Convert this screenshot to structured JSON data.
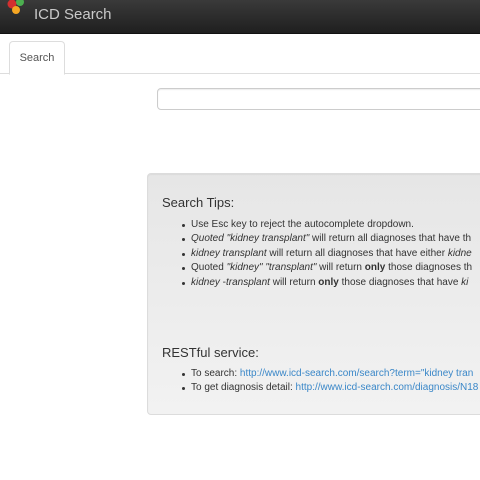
{
  "navbar": {
    "brand": "ICD Search",
    "logo_colors": [
      "#d32f2f",
      "#4caf50",
      "#f5a623"
    ]
  },
  "tabs": [
    {
      "label": "Search"
    }
  ],
  "search": {
    "value": ""
  },
  "tips": {
    "heading": "Search Tips:",
    "items": [
      {
        "text": "Use Esc key to reject the autocomplete dropdown."
      },
      {
        "em": "Quoted \"kidney transplant\"",
        "text": " will return all diagnoses that have th"
      },
      {
        "em": "kidney transplant",
        "text": " will return all diagnoses that have either ",
        "em2": "kidne"
      },
      {
        "pre": "Quoted ",
        "em": "\"kidney\" \"transplant\"",
        "mid": " will return ",
        "strong": "only",
        "text": " those diagnoses th"
      },
      {
        "em": "kidney",
        "mid": " -",
        "em_b": "transplant",
        "text": " will return ",
        "strong": "only",
        "text2": " those diagnoses that have ",
        "em2": "ki"
      }
    ]
  },
  "rest": {
    "heading": "RESTful service:",
    "items": [
      {
        "label": "To search: ",
        "link": "http://www.icd-search.com/search?term=\"kidney tran"
      },
      {
        "label": "To get diagnosis detail: ",
        "link": "http://www.icd-search.com/diagnosis/N18"
      }
    ]
  }
}
